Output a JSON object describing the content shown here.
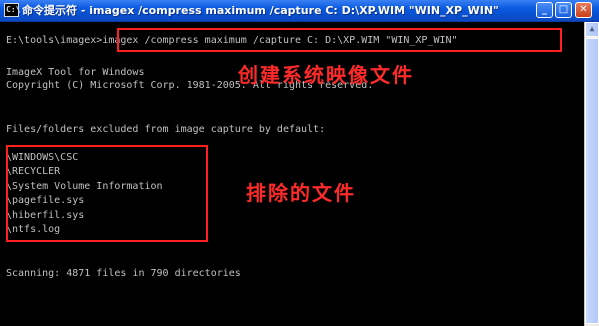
{
  "window": {
    "title": "命令提示符 - imagex /compress maximum /capture C: D:\\XP.WIM \"WIN_XP_WIN\"",
    "icon_text": "C:\\",
    "buttons": {
      "minimize": "_",
      "maximize": "□",
      "close": "✕"
    },
    "colors": {
      "titlebar": "#0a5ae0",
      "console_bg": "#000000",
      "console_text": "#c0c0c0",
      "annotation": "#ff2a2a"
    }
  },
  "console": {
    "prompt": "E:\\tools\\imagex>",
    "command": "imagex /compress maximum /capture C: D:\\XP.WIM \"WIN_XP_WIN\"",
    "tool_name": "ImageX Tool for Windows",
    "copyright": "Copyright (C) Microsoft Corp. 1981-2005. All rights reserved.",
    "excluded_header": "Files/folders excluded from image capture by default:",
    "excluded_items": [
      "\\WINDOWS\\CSC",
      "\\RECYCLER",
      "\\System Volume Information",
      "\\pagefile.sys",
      "\\hiberfil.sys",
      "\\ntfs.log"
    ],
    "scanning": "Scanning: 4871 files in 790 directories"
  },
  "annotations": {
    "create_image": "创建系统映像文件",
    "excluded_files": "排除的文件"
  }
}
